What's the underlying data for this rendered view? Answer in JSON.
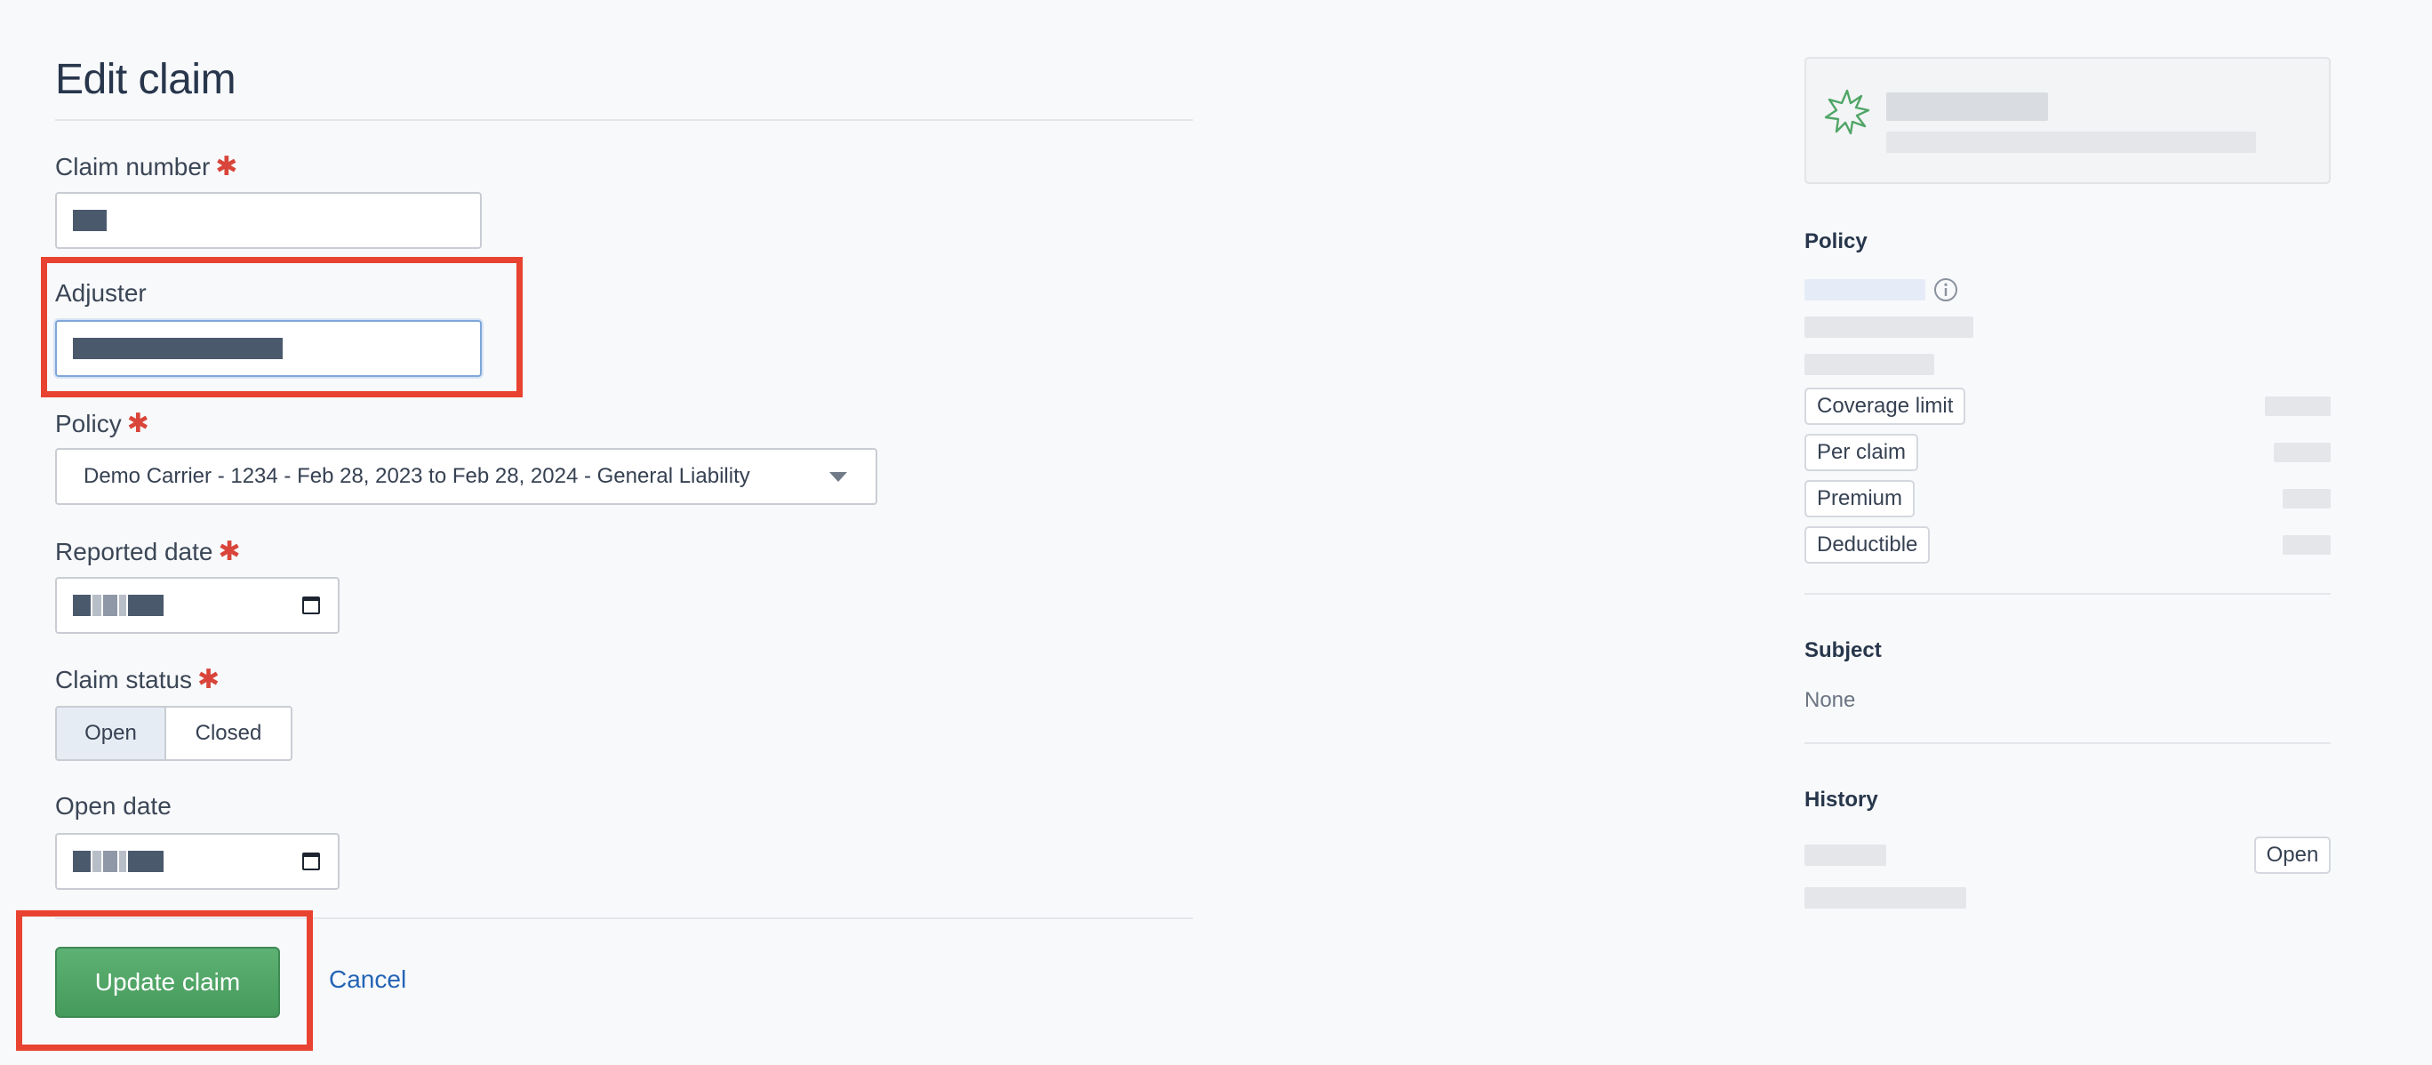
{
  "form": {
    "title": "Edit claim",
    "claim_number": {
      "label": "Claim number",
      "required_mark": "✱"
    },
    "adjuster": {
      "label": "Adjuster"
    },
    "policy": {
      "label": "Policy",
      "required_mark": "✱",
      "selected": "Demo Carrier - 1234 - Feb 28, 2023 to Feb 28, 2024 - General Liability"
    },
    "reported_date": {
      "label": "Reported date",
      "required_mark": "✱"
    },
    "claim_status": {
      "label": "Claim status",
      "required_mark": "✱",
      "options": [
        "Open",
        "Closed"
      ],
      "selected": "Open"
    },
    "open_date": {
      "label": "Open date"
    },
    "actions": {
      "submit_label": "Update claim",
      "cancel_label": "Cancel"
    }
  },
  "sidebar": {
    "policy": {
      "heading": "Policy",
      "tags": [
        "Coverage limit",
        "Per claim",
        "Premium",
        "Deductible"
      ]
    },
    "subject": {
      "heading": "Subject",
      "value": "None"
    },
    "history": {
      "heading": "History",
      "button_label": "Open"
    }
  },
  "colors": {
    "accent_green": "#4fa566",
    "link_blue": "#2464b5",
    "required_red": "#d9453a",
    "highlight_red": "#e84330"
  },
  "icons": [
    "calendar-icon",
    "chevron-down-icon",
    "info-icon",
    "starburst-icon"
  ]
}
